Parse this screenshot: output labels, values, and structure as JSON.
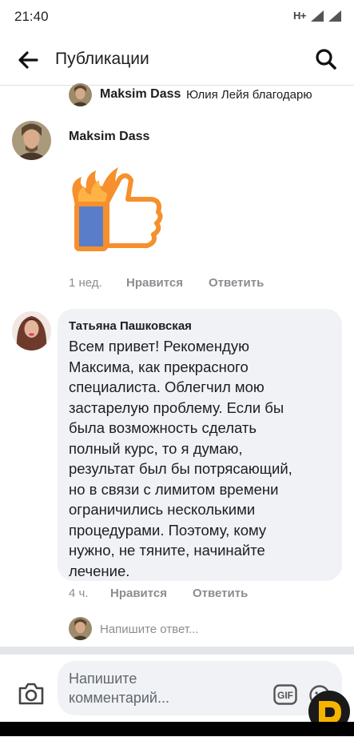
{
  "status_bar": {
    "time": "21:40",
    "network": "H+"
  },
  "header": {
    "title": "Публикации"
  },
  "reply_preview": {
    "author": "Maksim Dass",
    "text": "Юлия Лейя благодарю"
  },
  "comments": [
    {
      "author": "Maksim Dass",
      "sticker": "thumbs-up-fire",
      "time": "1 нед.",
      "like_label": "Нравится",
      "reply_label": "Ответить"
    },
    {
      "author": "Татьяна Пашковская",
      "text": "Всем привет! Рекомендую\nМаксима, как прекрасного\nспециалиста. Облегчил мою\nзастарелую проблему. Если бы\nбыла возможность сделать\nполный курс, то я думаю,\nрезультат был бы потрясающий,\nно в связи с лимитом времени\nограничились несколькими\nпроцедурами. Поэтому, кому\nнужно, не тяните, начинайте\nлечение.",
      "time": "4 ч.",
      "like_label": "Нравится",
      "reply_label": "Ответить"
    }
  ],
  "reply_input": {
    "placeholder": "Напишите ответ..."
  },
  "composer": {
    "placeholder": "Напишите\nкомментарий..."
  },
  "colors": {
    "accent": "#1877f2",
    "bubble": "#f0f2f5",
    "meta": "#8a8d91",
    "sticker_blue": "#5a7dc9",
    "sticker_orange": "#f6902c"
  }
}
